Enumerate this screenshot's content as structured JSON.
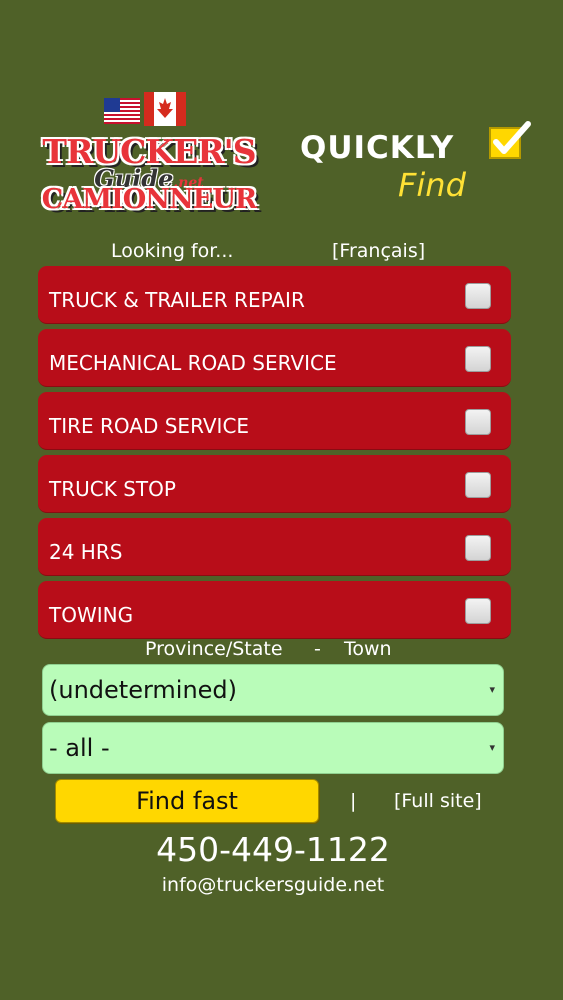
{
  "header": {
    "logo_top": "TRUCKER'S",
    "logo_mid": "Guide",
    "logo_net": ".net",
    "logo_bottom": "CAMIONNEUR",
    "quickly": "QUICKLY",
    "find": "Find"
  },
  "search": {
    "looking_for": "Looking for...",
    "language_link": "[Français]"
  },
  "services": [
    {
      "label": "TRUCK & TRAILER REPAIR",
      "checked": false
    },
    {
      "label": "MECHANICAL ROAD SERVICE",
      "checked": false
    },
    {
      "label": "TIRE ROAD SERVICE",
      "checked": false
    },
    {
      "label": "TRUCK STOP",
      "checked": false
    },
    {
      "label": "24 HRS",
      "checked": false
    },
    {
      "label": "TOWING",
      "checked": false
    }
  ],
  "location": {
    "province_label": "Province/State",
    "dash": "-",
    "town_label": "Town",
    "province_value": "(undetermined)",
    "town_value": "- all -"
  },
  "actions": {
    "find_fast": "Find fast",
    "separator": "|",
    "full_site": "[Full site]"
  },
  "contact": {
    "phone": "450-449-1122",
    "email": "info@truckersguide.net"
  },
  "colors": {
    "background": "#4f6128",
    "service_red": "#b80d19",
    "select_green": "#b9fcb9",
    "button_yellow": "#ffd700",
    "find_yellow": "#ffe135"
  }
}
